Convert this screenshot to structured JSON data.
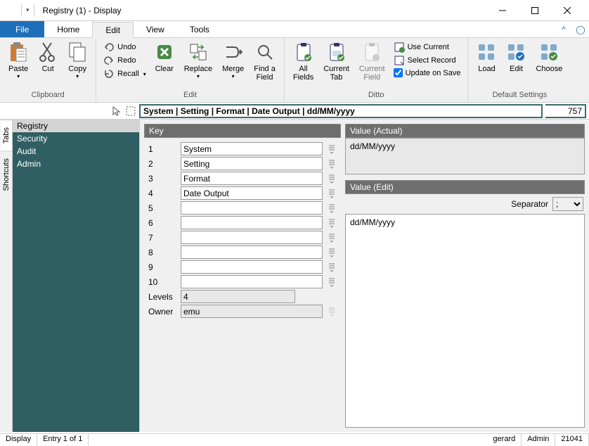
{
  "window": {
    "title": "Registry (1) - Display"
  },
  "ribbon": {
    "tabs": {
      "file": "File",
      "home": "Home",
      "edit": "Edit",
      "view": "View",
      "tools": "Tools"
    },
    "groups": {
      "clipboard": {
        "label": "Clipboard",
        "paste": "Paste",
        "cut": "Cut",
        "copy": "Copy"
      },
      "edit": {
        "label": "Edit",
        "undo": "Undo",
        "redo": "Redo",
        "recall": "Recall",
        "clear": "Clear",
        "replace": "Replace",
        "merge": "Merge",
        "find": "Find a\nField"
      },
      "ditto": {
        "label": "Ditto",
        "allfields": "All\nFields",
        "currenttab": "Current\nTab",
        "currentfield": "Current\nField",
        "usecurrent": "Use Current",
        "selectrecord": "Select Record",
        "updatesave": "Update on Save"
      },
      "defaults": {
        "label": "Default Settings",
        "load": "Load",
        "dedit": "Edit",
        "choose": "Choose"
      }
    }
  },
  "toolstrip": {
    "breadcrumb": "System | Setting | Format | Date Output | dd/MM/yyyy",
    "counter": "757"
  },
  "sidebar": {
    "rails": {
      "tabs": "Tabs",
      "shortcuts": "Shortcuts"
    },
    "items": [
      "Registry",
      "Security",
      "Audit",
      "Admin"
    ]
  },
  "key": {
    "header": "Key",
    "rows": [
      "System",
      "Setting",
      "Format",
      "Date Output",
      "",
      "",
      "",
      "",
      "",
      ""
    ],
    "levels_label": "Levels",
    "levels_value": "4",
    "owner_label": "Owner",
    "owner_value": "emu"
  },
  "value": {
    "actual_header": "Value (Actual)",
    "actual": "dd/MM/yyyy",
    "edit_header": "Value (Edit)",
    "separator_label": "Separator",
    "separator_value": ";",
    "edit": "dd/MM/yyyy"
  },
  "status": {
    "mode": "Display",
    "entry": "Entry 1 of 1",
    "user": "gerard",
    "role": "Admin",
    "build": "21041"
  }
}
